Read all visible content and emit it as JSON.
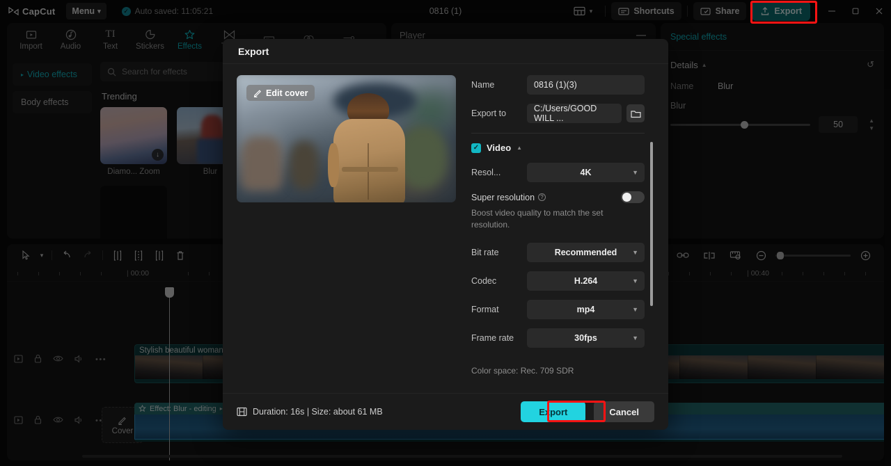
{
  "titlebar": {
    "brand": "CapCut",
    "menu_label": "Menu",
    "autosave_text": "Auto saved: 11:05:21",
    "document_title": "0816 (1)",
    "layout_label": "",
    "shortcuts_label": "Shortcuts",
    "share_label": "Share",
    "export_label": "Export",
    "minimize_label": "─",
    "maximize_label": "❐",
    "close_label": "✕"
  },
  "tabs": [
    {
      "label": "Import",
      "icon": "import-icon",
      "active": false
    },
    {
      "label": "Audio",
      "icon": "audio-icon",
      "active": false
    },
    {
      "label": "Text",
      "icon": "text-icon",
      "active": false
    },
    {
      "label": "Stickers",
      "icon": "stickers-icon",
      "active": false
    },
    {
      "label": "Effects",
      "icon": "effects-icon",
      "active": true
    },
    {
      "label": "Tran",
      "icon": "transitions-icon",
      "active": false
    }
  ],
  "left_panel": {
    "sidebar": [
      {
        "label": "Video effects",
        "active": true
      },
      {
        "label": "Body effects",
        "active": false
      }
    ],
    "search_placeholder": "Search for effects",
    "section_title": "Trending",
    "effects": [
      {
        "label": "Diamo... Zoom",
        "has_download": true
      },
      {
        "label": "Blur",
        "has_download": false
      }
    ]
  },
  "player": {
    "label": "Player"
  },
  "right_panel": {
    "tab_label": "Special effects",
    "details_label": "Details",
    "reset_icon": "reset-icon",
    "name_label": "Name",
    "name_value": "Blur",
    "slider_label": "Blur",
    "slider_value": "50"
  },
  "timeline": {
    "tools_left": [
      {
        "name": "select-tool",
        "glyph": "➤"
      },
      {
        "name": "tool-dropdown",
        "glyph": "⌄"
      },
      {
        "name": "undo",
        "glyph": "↶"
      },
      {
        "name": "redo",
        "glyph": "↷"
      },
      {
        "name": "split-left",
        "glyph": "]["
      },
      {
        "name": "split",
        "glyph": "]["
      },
      {
        "name": "split-right",
        "glyph": "]["
      },
      {
        "name": "delete",
        "glyph": "Ὕ1"
      }
    ],
    "tools_right": [
      {
        "name": "auto-cut",
        "glyph": "≡"
      },
      {
        "name": "link",
        "glyph": "⚭"
      },
      {
        "name": "mirror",
        "glyph": "⌶"
      },
      {
        "name": "measure",
        "glyph": "▧"
      },
      {
        "name": "zoom-out",
        "glyph": "⊖"
      },
      {
        "name": "zoom-in",
        "glyph": "⊕"
      }
    ],
    "ruler_labels": [
      "00:00",
      "00:40"
    ],
    "cover_label": "Cover",
    "clips": [
      {
        "type": "video",
        "title": "Stylish beautiful woman w"
      },
      {
        "type": "effect",
        "title": "Effect: Blur - editing"
      }
    ],
    "track_controls": [
      "play-icon",
      "lock-icon",
      "eye-icon",
      "volume-icon",
      "more-icon"
    ]
  },
  "modal": {
    "title": "Export",
    "edit_cover_label": "Edit cover",
    "name_label": "Name",
    "name_value": "0816 (1)(3)",
    "export_to_label": "Export to",
    "export_to_value": "C:/Users/GOOD WILL ...",
    "video_label": "Video",
    "resolution_label": "Resol...",
    "resolution_value": "4K",
    "super_resolution_label": "Super resolution",
    "super_resolution_help": "Boost video quality to match the set resolution.",
    "super_resolution_on": false,
    "bitrate_label": "Bit rate",
    "bitrate_value": "Recommended",
    "codec_label": "Codec",
    "codec_value": "H.264",
    "format_label": "Format",
    "format_value": "mp4",
    "framerate_label": "Frame rate",
    "framerate_value": "30fps",
    "color_space": "Color space: Rec. 709 SDR",
    "duration_text": "Duration: 16s | Size: about 61 MB",
    "export_button": "Export",
    "cancel_button": "Cancel"
  },
  "colors": {
    "accent_teal": "#12b7c3",
    "export_footer": "#22d3e0",
    "export_top": "#0d6f72",
    "highlight_red": "#ff1313"
  }
}
